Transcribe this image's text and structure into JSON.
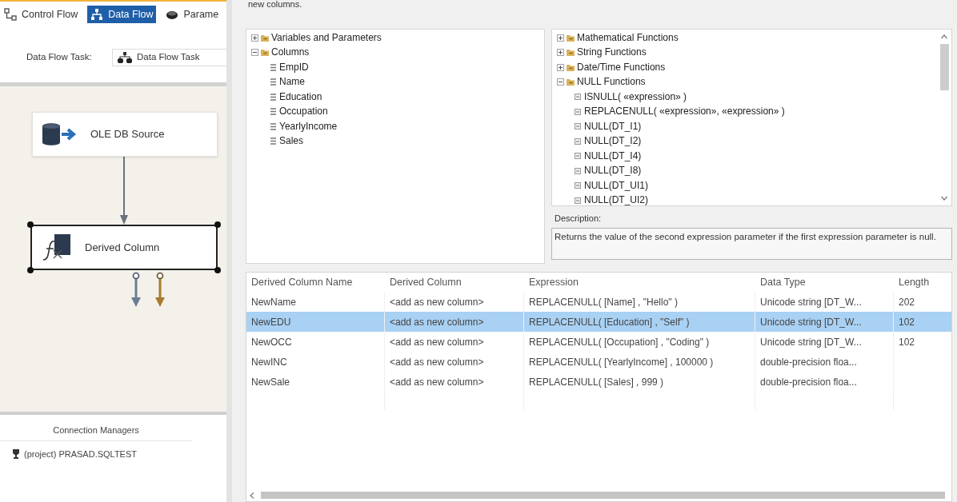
{
  "designer": {
    "tabs": [
      {
        "label": "Control Flow",
        "selected": false
      },
      {
        "label": "Data Flow",
        "selected": true
      },
      {
        "label": "Parame",
        "selected": false
      }
    ],
    "task_label": "Data Flow Task:",
    "task_dropdown": "Data Flow Task"
  },
  "canvas": {
    "nodes": [
      {
        "kind": "source",
        "label": "OLE DB Source",
        "selected": false
      },
      {
        "kind": "transform",
        "label": "Derived Column",
        "selected": true
      }
    ]
  },
  "connection_managers": {
    "tab": "Connection Managers",
    "items": [
      "(project) PRASAD.SQLTEST"
    ]
  },
  "dialog": {
    "instruction": "new columns.",
    "input_tree": [
      {
        "label": "Variables and Parameters",
        "expanded": false
      },
      {
        "label": "Columns",
        "expanded": true,
        "children": [
          {
            "label": "EmpID"
          },
          {
            "label": "Name"
          },
          {
            "label": "Education"
          },
          {
            "label": "Occupation"
          },
          {
            "label": "YearlyIncome"
          },
          {
            "label": "Sales"
          }
        ]
      }
    ],
    "function_tree": [
      {
        "label": "Mathematical Functions",
        "expanded": false
      },
      {
        "label": "String Functions",
        "expanded": false
      },
      {
        "label": "Date/Time Functions",
        "expanded": false
      },
      {
        "label": "NULL Functions",
        "expanded": true,
        "children": [
          {
            "label": "ISNULL( «expression» )"
          },
          {
            "label": "REPLACENULL( «expression», «expression» )"
          },
          {
            "label": "NULL(DT_I1)"
          },
          {
            "label": "NULL(DT_I2)"
          },
          {
            "label": "NULL(DT_I4)"
          },
          {
            "label": "NULL(DT_I8)"
          },
          {
            "label": "NULL(DT_UI1)"
          },
          {
            "label": "NULL(DT_UI2)"
          }
        ]
      }
    ],
    "description": {
      "label": "Description:",
      "text": "Returns the value of the second expression parameter if the first expression parameter is null."
    },
    "grid": {
      "columns": [
        "Derived Column Name",
        "Derived Column",
        "Expression",
        "Data Type",
        "Length"
      ],
      "rows": [
        {
          "selected": false,
          "cells": [
            "NewName",
            "<add as new column>",
            "REPLACENULL( [Name] , \"Hello\" )",
            "Unicode string [DT_W...",
            "202"
          ]
        },
        {
          "selected": true,
          "cells": [
            "NewEDU",
            "<add as new column>",
            "REPLACENULL( [Education] , \"Self\" )",
            "Unicode string [DT_W...",
            "102"
          ]
        },
        {
          "selected": false,
          "cells": [
            "NewOCC",
            "<add as new column>",
            "REPLACENULL( [Occupation] , \"Coding\" )",
            "Unicode string [DT_W...",
            "102"
          ]
        },
        {
          "selected": false,
          "cells": [
            "NewINC",
            "<add as new column>",
            "REPLACENULL( [YearlyIncome] , 100000 )",
            "double-precision floa..."
          ]
        },
        {
          "selected": false,
          "cells": [
            "NewSale",
            "<add as new column>",
            "REPLACENULL( [Sales] , 999 )",
            "double-precision floa..."
          ]
        }
      ]
    }
  }
}
